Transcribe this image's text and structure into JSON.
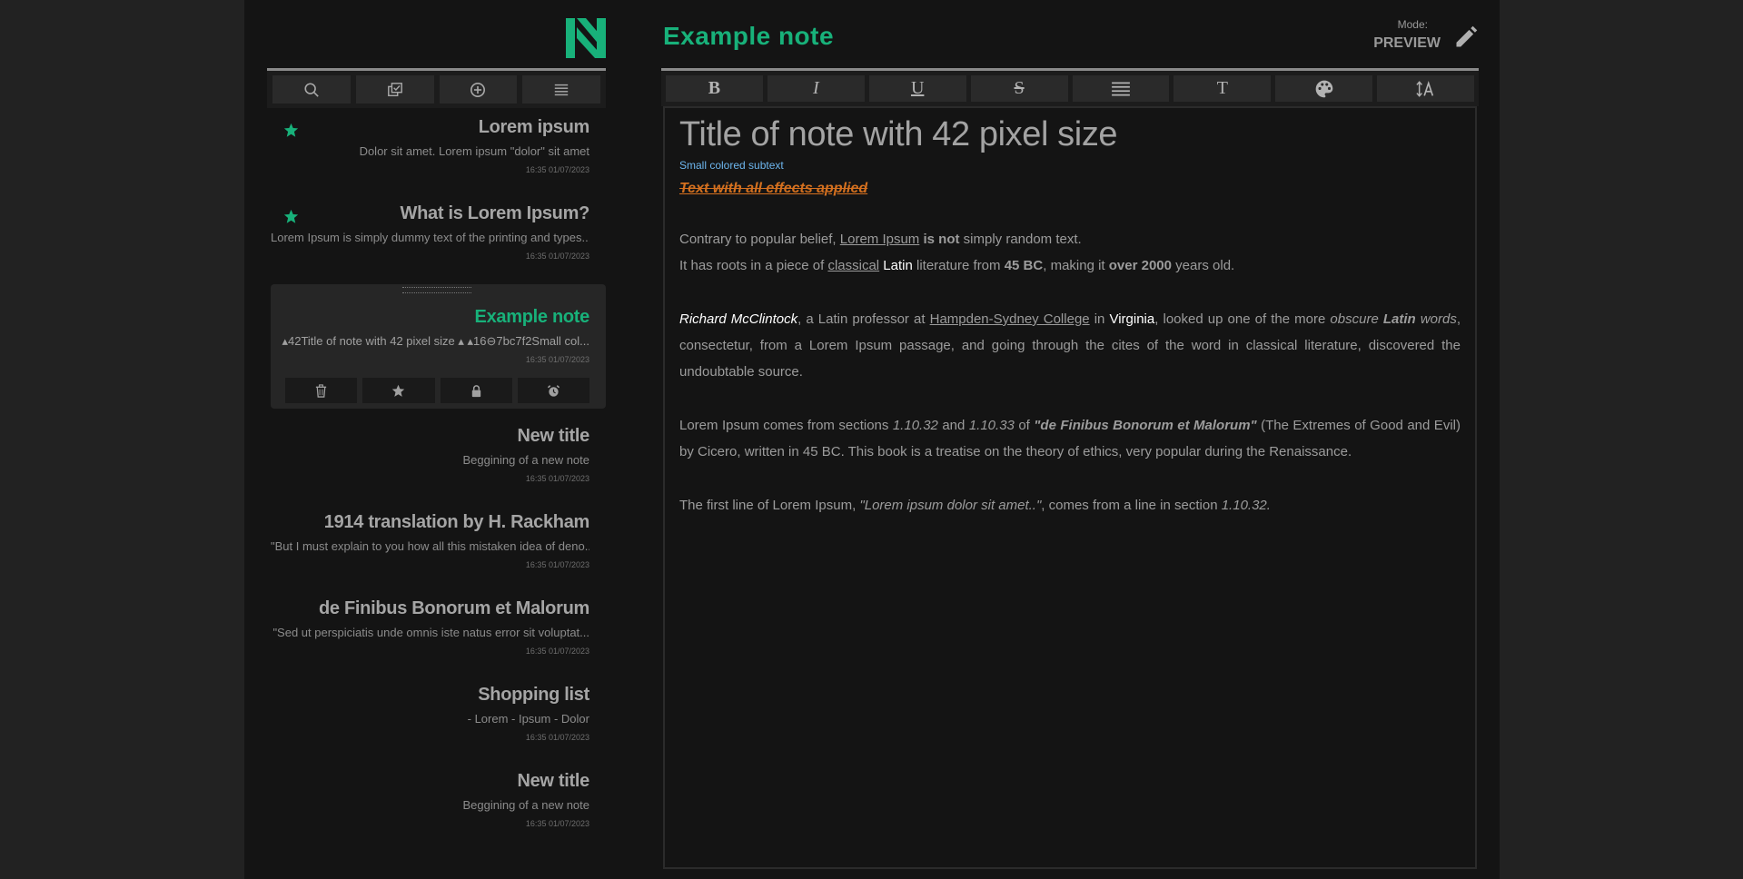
{
  "colors": {
    "accent": "#18b17a",
    "subtext": "#6db6ee",
    "effect": "#d4701f",
    "background": "#141414",
    "page": "#222222"
  },
  "sidebar": {
    "logo": "n-logo-icon",
    "toolbar": [
      {
        "name": "search-icon"
      },
      {
        "name": "select-notes-icon"
      },
      {
        "name": "add-note-icon"
      },
      {
        "name": "menu-icon"
      }
    ],
    "notes": [
      {
        "title": "Lorem ipsum",
        "preview": "Dolor sit amet. Lorem ipsum \"dolor\" sit amet",
        "date": "16:35 01/07/2023",
        "starred": true
      },
      {
        "title": "What is Lorem Ipsum?",
        "preview": "Lorem Ipsum is simply dummy text of the printing and types...",
        "date": "16:35 01/07/2023",
        "starred": true
      },
      {
        "title": "Example note",
        "preview": "▴42Title of note with 42 pixel size ▴   ▴16⊖7bc7f2Small col...",
        "date": "16:35 01/07/2023",
        "active": true
      },
      {
        "title": "New title",
        "preview": "Beggining of a new note",
        "date": "16:35 01/07/2023"
      },
      {
        "title": "1914 translation by H. Rackham",
        "preview": "\"But I must explain to you how all this mistaken idea of deno...",
        "date": "16:35 01/07/2023"
      },
      {
        "title": "de Finibus Bonorum et Malorum",
        "preview": "\"Sed ut perspiciatis unde omnis iste natus error sit voluptat...",
        "date": "16:35 01/07/2023"
      },
      {
        "title": "Shopping list",
        "preview": "- Lorem - Ipsum - Dolor",
        "date": "16:35 01/07/2023"
      },
      {
        "title": "New title",
        "preview": "Beggining of a new note",
        "date": "16:35 01/07/2023"
      }
    ],
    "active_actions": [
      "trash-icon",
      "star-icon",
      "lock-icon",
      "alarm-icon"
    ]
  },
  "editor": {
    "title": "Example note",
    "mode_label": "Mode:",
    "mode_value": "PREVIEW",
    "toolbar": [
      "bold-icon",
      "italic-icon",
      "underline-icon",
      "strikethrough-icon",
      "align-icon",
      "text-size-icon",
      "color-palette-icon",
      "font-size-icon"
    ],
    "toolbar_glyphs": {
      "bold": "B",
      "italic": "I",
      "underline": "U",
      "strike": "S",
      "textsize": "T"
    },
    "content": {
      "h1": "Title of note with 42 pixel size",
      "subtext": "Small colored subtext",
      "effects": "Text with all effects applied",
      "p1": {
        "a": "Contrary to popular belief, ",
        "b": "Lorem Ipsum",
        "c": " ",
        "d": "is not",
        "e": " simply random text."
      },
      "p2": {
        "a": "It has roots in a piece of ",
        "b": "classical",
        "c": " ",
        "d": "Latin",
        "e": " literature from ",
        "f": "45 BC",
        "g": ", making it ",
        "h": "over 2000",
        "i": " years old."
      },
      "p3": {
        "a": "Richard McClintock",
        "b": ", a Latin professor at ",
        "c": "Hampden-Sydney College",
        "d": " in ",
        "e": "Virginia",
        "f": ", looked up one of the more ",
        "g": "obscure",
        "h": " ",
        "i": "Latin",
        "j": " ",
        "k": "words",
        "l": ", consectetur, from a Lorem Ipsum passage, and going through the cites of the word in classical literature, discovered the undoubtable source."
      },
      "p4": {
        "a": "Lorem Ipsum comes from sections ",
        "b": "1.10.32",
        "c": " and ",
        "d": "1.10.33",
        "e": " of ",
        "f": "\"de Finibus Bonorum et Malorum\"",
        "g": " (The Extremes of Good and Evil) by Cicero, written in 45 BC. This book is a treatise on the theory of ethics, very popular during the Renaissance."
      },
      "p5": {
        "a": "The first line of Lorem Ipsum, ",
        "b": "\"Lorem ipsum dolor sit amet..\"",
        "c": ", comes from a line in section ",
        "d": "1.10.32."
      }
    }
  }
}
